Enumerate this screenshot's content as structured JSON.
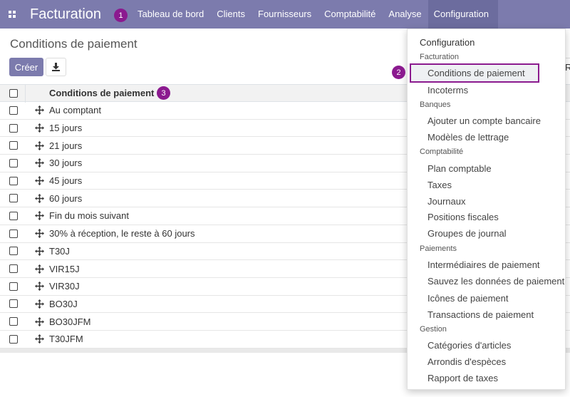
{
  "navbar": {
    "app_title": "Facturation",
    "menu": [
      "Tableau de bord",
      "Clients",
      "Fournisseurs",
      "Comptabilité",
      "Analyse",
      "Configuration"
    ],
    "active": "Configuration",
    "color": "#7c7bad"
  },
  "callouts": [
    "1",
    "2",
    "3"
  ],
  "control_panel": {
    "title": "Conditions de paiement",
    "create_label": "Créer",
    "download_icon": "download-icon"
  },
  "list": {
    "column": "Conditions de paiement",
    "rows": [
      "Au comptant",
      "15 jours",
      "21 jours",
      "30 jours",
      "45 jours",
      "60 jours",
      "Fin du mois suivant",
      "30% à réception, le reste à 60 jours",
      "T30J",
      "VIR15J",
      "VIR30J",
      "BO30J",
      "BO30JFM",
      "T30JFM"
    ]
  },
  "dropdown": {
    "title": "Configuration",
    "sections": [
      {
        "header": "Facturation",
        "items": [
          "Conditions de paiement",
          "Incoterms"
        ]
      },
      {
        "header": "Banques",
        "items": [
          "Ajouter un compte bancaire",
          "Modèles de lettrage"
        ]
      },
      {
        "header": "Comptabilité",
        "items": [
          "Plan comptable",
          "Taxes",
          "Journaux",
          "Positions fiscales",
          "Groupes de journal"
        ]
      },
      {
        "header": "Paiements",
        "items": [
          "Intermédiaires de paiement",
          "Sauvez les données de paiement",
          "Icônes de paiement",
          "Transactions de paiement"
        ]
      },
      {
        "header": "Gestion",
        "items": [
          "Catégories d'articles",
          "Arrondis d'espèces",
          "Rapport de taxes"
        ]
      }
    ],
    "highlighted": "Conditions de paiement",
    "highlight_color": "#8b1a8f"
  },
  "partial_text": "R"
}
